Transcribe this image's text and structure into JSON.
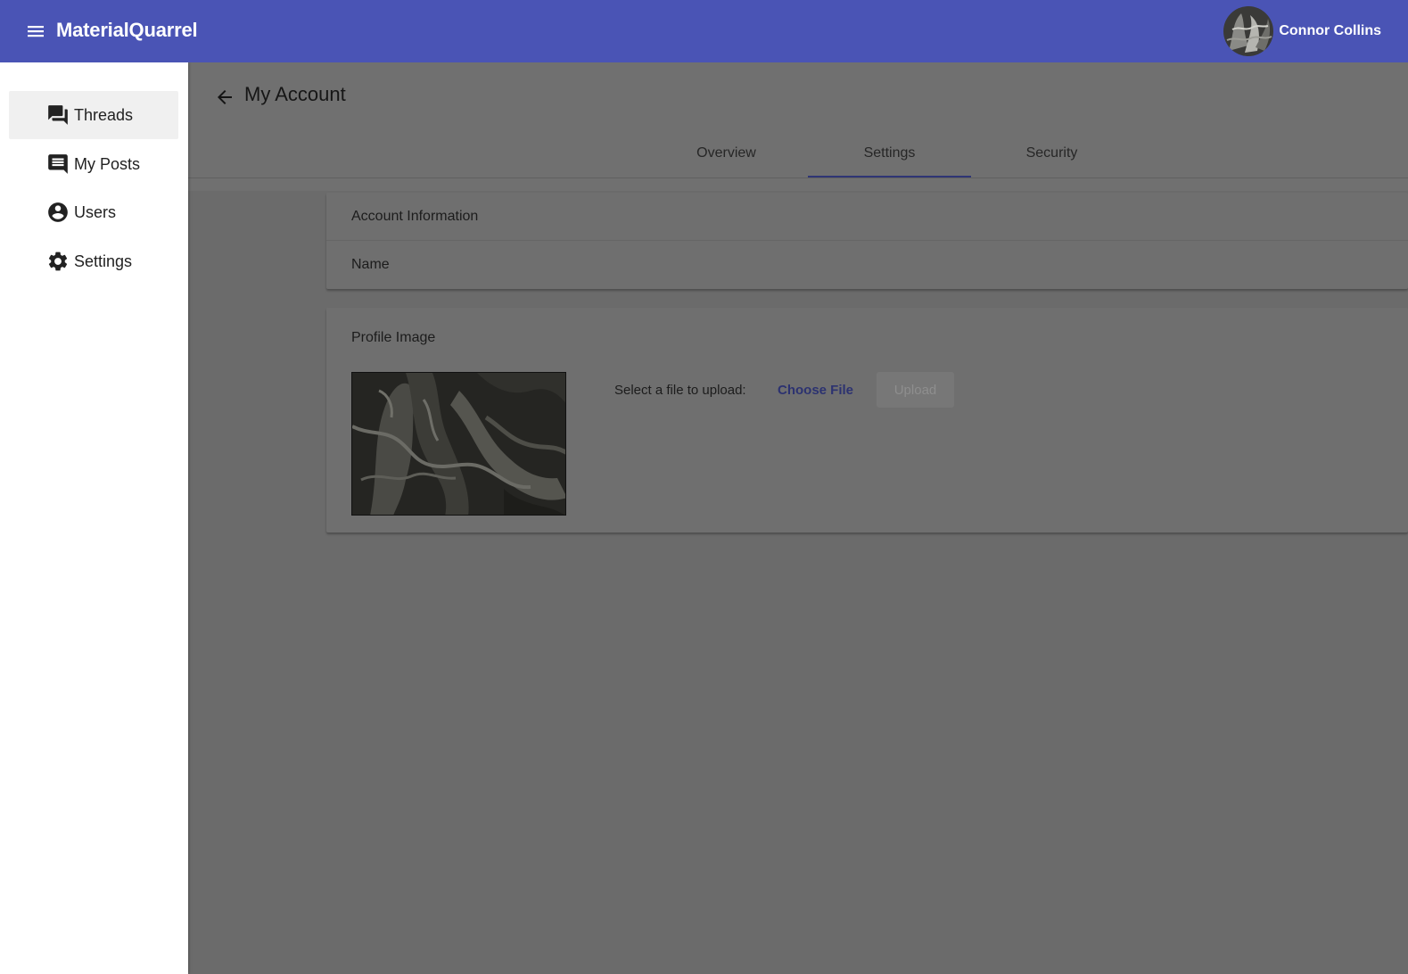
{
  "app": {
    "title": "MaterialQuarrel",
    "brand_color": "#4a54b5",
    "user": {
      "name": "Connor Collins"
    }
  },
  "sidebar": {
    "items": [
      {
        "label": "Threads",
        "icon": "forum-icon",
        "active": true
      },
      {
        "label": "My Posts",
        "icon": "comment-icon",
        "active": false
      },
      {
        "label": "Users",
        "icon": "account-circle-icon",
        "active": false
      },
      {
        "label": "Settings",
        "icon": "gear-icon",
        "active": false
      }
    ]
  },
  "page": {
    "title": "My Account",
    "tabs": [
      {
        "label": "Overview",
        "active": false
      },
      {
        "label": "Settings",
        "active": true
      },
      {
        "label": "Security",
        "active": false
      }
    ]
  },
  "account_card": {
    "heading": "Account Information",
    "name_label": "Name"
  },
  "profile_card": {
    "heading": "Profile Image",
    "upload_label": "Select a file to upload:",
    "choose_file_label": "Choose File",
    "upload_button_label": "Upload"
  }
}
